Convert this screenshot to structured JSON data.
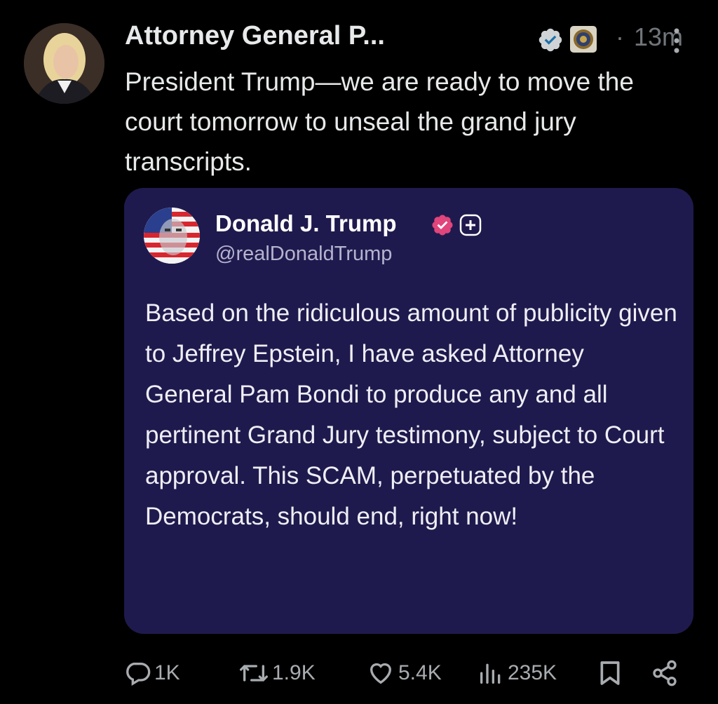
{
  "post": {
    "author_name": "Attorney General P...",
    "dot": "·",
    "time": "13m",
    "text": "President Trump—we are ready to move the court tomorrow to unseal the grand jury transcripts."
  },
  "quote": {
    "author_name": "Donald J. Trump",
    "handle": "@realDonaldTrump",
    "text": "Based on the ridiculous amount of publicity given to Jeffrey Epstein, I have asked Attorney General Pam Bondi to produce any and all pertinent Grand Jury testimony, subject to Court approval. This SCAM, perpetuated by the Democrats, should end, right now!"
  },
  "actions": {
    "replies": "1K",
    "reposts": "1.9K",
    "likes": "5.4K",
    "views": "235K"
  },
  "icons": {
    "verified": "verified-badge-icon",
    "affiliation": "affiliation-seal-icon",
    "grok": "grok-icon",
    "more": "more-icon",
    "reply": "reply-icon",
    "repost": "repost-icon",
    "like": "like-icon",
    "views": "views-icon",
    "bookmark": "bookmark-icon",
    "share": "share-icon"
  },
  "colors": {
    "background": "#000000",
    "quote_background": "#1f1a4d",
    "verified_blue": "#1d9bf0",
    "quote_badge_pink": "#e0457b",
    "muted": "#71767b"
  }
}
